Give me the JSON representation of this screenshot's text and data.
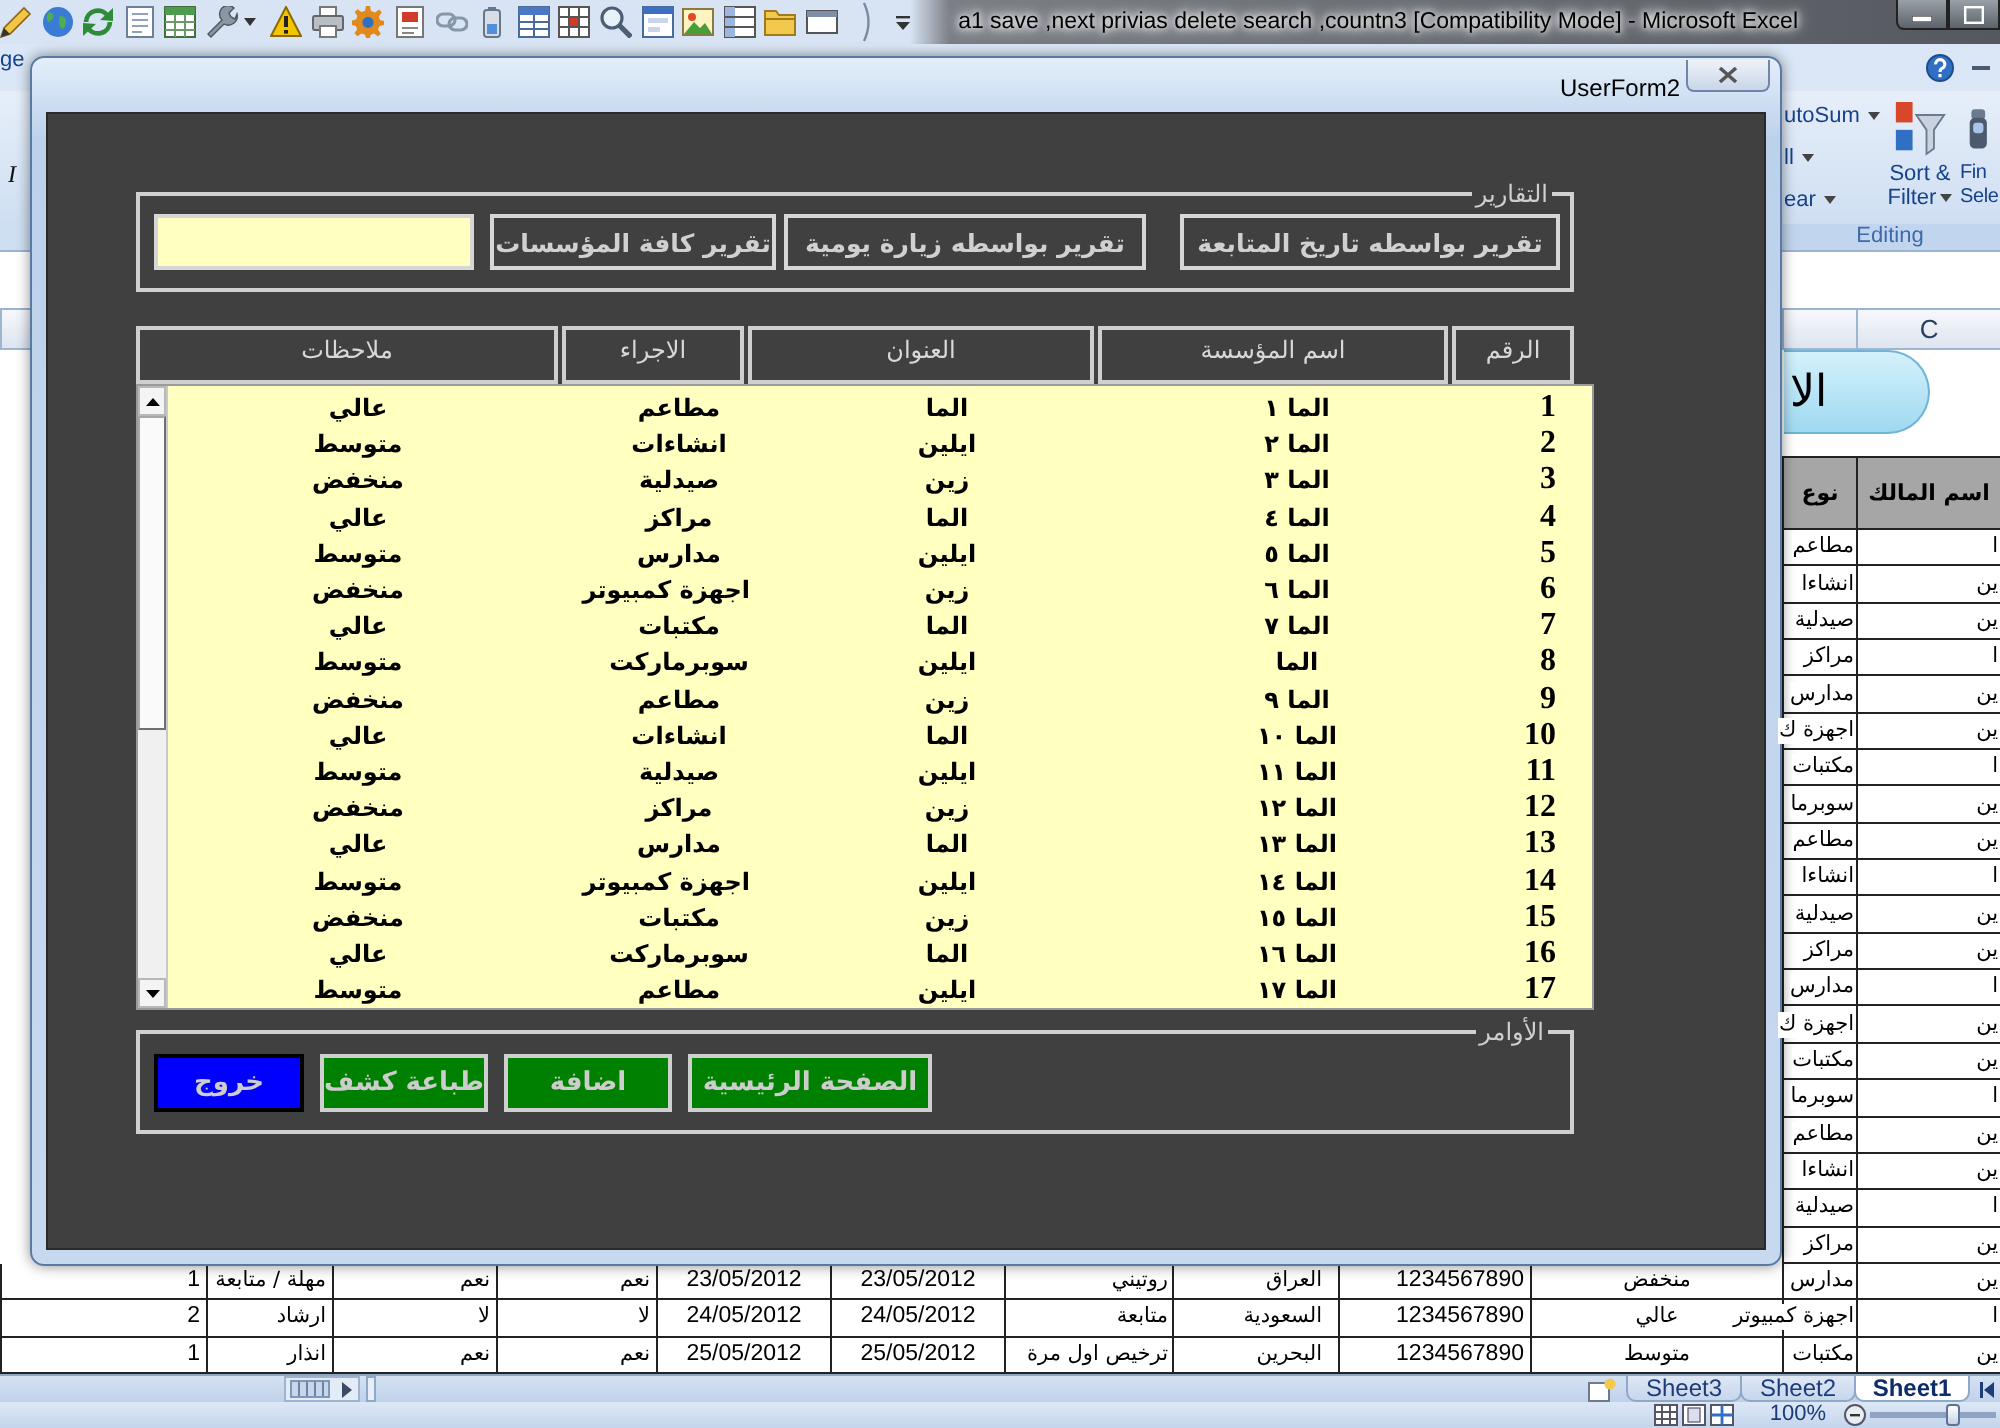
{
  "excel": {
    "title": "a1 save ,next privias delete search ,countn3 [Compatibility Mode] - Microsoft Excel",
    "ribbon": {
      "tab": "ge",
      "italic": "I",
      "autosum": "utoSum",
      "fill": "ll",
      "clear": "ear",
      "sort_filter": "Sort & Filter",
      "find_select": [
        "Fin",
        "Sele"
      ],
      "group": "Editing"
    },
    "sheet": {
      "column_header": "C",
      "banner": "الا",
      "header_cells": [
        "اسم المالك",
        "نوع"
      ],
      "rows": [
        [
          "ا",
          "مطاعم"
        ],
        [
          "ين",
          "انشاءا"
        ],
        [
          "ين",
          "صيدلية"
        ],
        [
          "ا",
          "مراكز"
        ],
        [
          "ين",
          "مدارس"
        ],
        [
          "ين",
          "اجهزة ك"
        ],
        [
          "ا",
          "مكتبات"
        ],
        [
          "ين",
          "سوبرما"
        ],
        [
          "ين",
          "مطاعم"
        ],
        [
          "ا",
          "انشاءا"
        ],
        [
          "ين",
          "صيدلية"
        ],
        [
          "ين",
          "مراكز"
        ],
        [
          "ا",
          "مدارس"
        ],
        [
          "ين",
          "اجهزة ك"
        ],
        [
          "ين",
          "مكتبات"
        ],
        [
          "ا",
          "سوبرما"
        ],
        [
          "ين",
          "مطاعم"
        ],
        [
          "ين",
          "انشاءا"
        ],
        [
          "ا",
          "صيدلية"
        ],
        [
          "ين",
          "مراكز"
        ],
        [
          "ين",
          "مدارس",
          "منخفض",
          "1234567890",
          "العراق",
          "روتيني",
          "23/05/2012",
          "23/05/2012",
          "نعم",
          "نعم",
          "مهلة / متابعة",
          "1"
        ],
        [
          "ا",
          "اجهزة كمبيوتر",
          "عالي",
          "1234567890",
          "السعودية",
          "متابعة",
          "24/05/2012",
          "24/05/2012",
          "لا",
          "لا",
          "ارشاد",
          "2"
        ],
        [
          "ين",
          "مكتبات",
          "متوسط",
          "1234567890",
          "البحرين",
          "ترخيص اول مرة",
          "25/05/2012",
          "25/05/2012",
          "نعم",
          "نعم",
          "انذار",
          "1"
        ]
      ]
    },
    "sheet_tabs": [
      {
        "label": "Sheet1",
        "selected": true
      },
      {
        "label": "Sheet2",
        "selected": false
      },
      {
        "label": "Sheet3",
        "selected": false
      }
    ],
    "status_bar": {
      "zoom": "100%",
      "zoom_slider": {
        "level": 0.67
      }
    }
  },
  "form": {
    "title": "UserForm2",
    "reports": {
      "caption": "التقارير",
      "buttons": [
        "تقرير بواسطه تاريخ المتابعة",
        "تقرير بواسطه زيارة يومية",
        "تقرير كافة المؤسسات"
      ]
    },
    "list": {
      "columns": [
        "الرقم",
        "اسم المؤسسة",
        "العنوان",
        "الاجراء",
        "ملاحظات"
      ],
      "rows": [
        [
          "1",
          "الما ١",
          "الما",
          "مطاعم",
          "عالي"
        ],
        [
          "2",
          "الما ٢",
          "ايلين",
          "انشاءات",
          "متوسط"
        ],
        [
          "3",
          "الما ٣",
          "زين",
          "صيدلية",
          "منخفض"
        ],
        [
          "4",
          "الما ٤",
          "الما",
          "مراكز",
          "عالي"
        ],
        [
          "5",
          "الما ٥",
          "ايلين",
          "مدارس",
          "متوسط"
        ],
        [
          "6",
          "الما ٦",
          "زين",
          "اجهزة كمبيوتر",
          "منخفض"
        ],
        [
          "7",
          "الما ٧",
          "الما",
          "مكتبات",
          "عالي"
        ],
        [
          "8",
          "الما",
          "ايلين",
          "سوبرماركت",
          "متوسط"
        ],
        [
          "9",
          "الما ٩",
          "زين",
          "مطاعم",
          "منخفض"
        ],
        [
          "10",
          "الما ١٠",
          "الما",
          "انشاءات",
          "عالي"
        ],
        [
          "11",
          "الما ١١",
          "ايلين",
          "صيدلية",
          "متوسط"
        ],
        [
          "12",
          "الما ١٢",
          "زين",
          "مراكز",
          "منخفض"
        ],
        [
          "13",
          "الما ١٣",
          "الما",
          "مدارس",
          "عالي"
        ],
        [
          "14",
          "الما ١٤",
          "ايلين",
          "اجهزة كمبيوتر",
          "متوسط"
        ],
        [
          "15",
          "الما ١٥",
          "زين",
          "مكتبات",
          "منخفض"
        ],
        [
          "16",
          "الما ١٦",
          "الما",
          "سوبرماركت",
          "عالي"
        ],
        [
          "17",
          "الما ١٧",
          "ايلين",
          "مطاعم",
          "متوسط"
        ]
      ]
    },
    "commands": {
      "caption": "الأوامر",
      "buttons": [
        {
          "label": "الصفحة الرئيسية",
          "color": "#008000",
          "focused": false
        },
        {
          "label": "اضافة",
          "color": "#008000",
          "focused": false
        },
        {
          "label": "طباعة كشف",
          "color": "#008000",
          "focused": false
        },
        {
          "label": "خروج",
          "color": "#0000ff",
          "focused": true
        }
      ]
    }
  }
}
